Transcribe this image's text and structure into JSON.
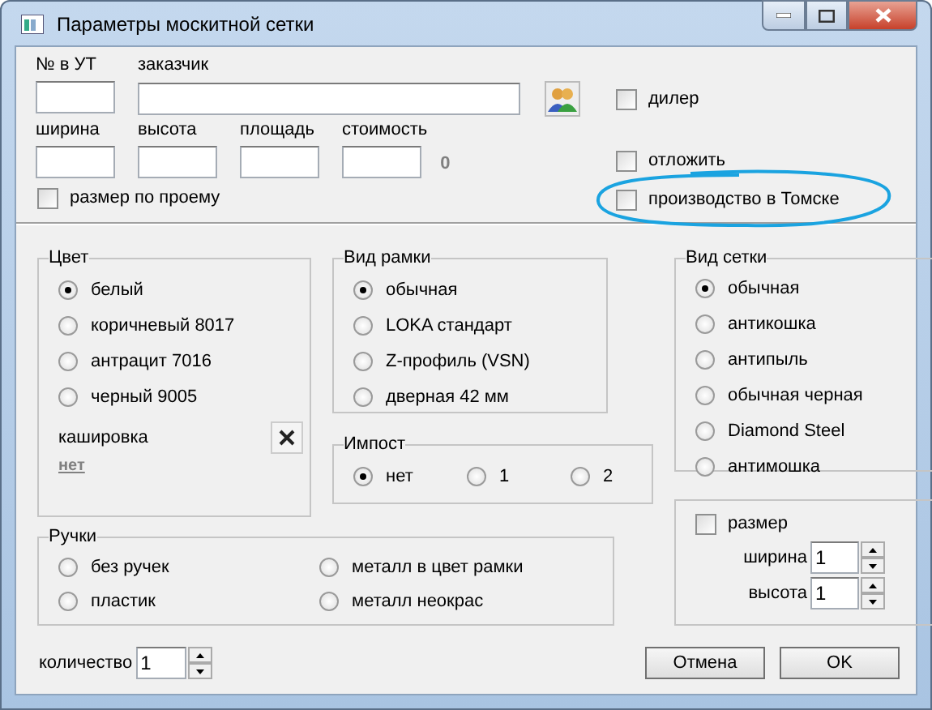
{
  "window": {
    "title": "Параметры москитной сетки"
  },
  "order_fields": [
    {
      "label": "№ в УТ",
      "kind": "short"
    },
    {
      "label": "заказчик",
      "kind": "lookup"
    }
  ],
  "size_fields": [
    {
      "label": "ширина"
    },
    {
      "label": "высота"
    },
    {
      "label": "площадь"
    },
    {
      "label": "стоимость"
    }
  ],
  "cost_total": "0",
  "size_by_opening": {
    "label": "размер по проему",
    "checked": false
  },
  "options": [
    {
      "label": "дилер",
      "checked": false,
      "highlighted": false
    },
    {
      "label": "отложить",
      "checked": false,
      "highlighted": false
    },
    {
      "label": "производство в Томске",
      "checked": false,
      "highlighted": true
    }
  ],
  "color_group": {
    "title": "Цвет",
    "options": [
      {
        "label": "белый",
        "selected": true
      },
      {
        "label": "коричневый 8017",
        "selected": false
      },
      {
        "label": "антрацит 7016",
        "selected": false
      },
      {
        "label": "черный 9005",
        "selected": false
      }
    ],
    "lamination_label": "кашировка",
    "lamination_value": "нет"
  },
  "frame_group": {
    "title": "Вид рамки",
    "options": [
      {
        "label": "обычная",
        "selected": true
      },
      {
        "label": "LOKA стандарт",
        "selected": false
      },
      {
        "label": "Z-профиль (VSN)",
        "selected": false
      },
      {
        "label": "дверная 42 мм",
        "selected": false
      }
    ]
  },
  "impost_group": {
    "title": "Импост",
    "options": [
      {
        "label": "нет",
        "selected": true
      },
      {
        "label": "1",
        "selected": false
      },
      {
        "label": "2",
        "selected": false
      }
    ]
  },
  "mesh_group": {
    "title": "Вид сетки",
    "options": [
      {
        "label": "обычная",
        "selected": true
      },
      {
        "label": "антикошка",
        "selected": false
      },
      {
        "label": "антипыль",
        "selected": false
      },
      {
        "label": "обычная черная",
        "selected": false
      },
      {
        "label": "Diamond Steel",
        "selected": false
      },
      {
        "label": "антимошка",
        "selected": false
      }
    ]
  },
  "handles_group": {
    "title": "Ручки",
    "options": [
      {
        "label": "без ручек",
        "selected": false
      },
      {
        "label": "пластик",
        "selected": false
      },
      {
        "label": "металл в цвет рамки",
        "selected": false
      },
      {
        "label": "металл неокрас",
        "selected": false
      }
    ]
  },
  "custom_size": {
    "label": "размер",
    "checked": false,
    "fields": [
      {
        "label": "ширина",
        "value": "1"
      },
      {
        "label": "высота",
        "value": "1"
      }
    ]
  },
  "quantity": {
    "label": "количество",
    "value": "1"
  },
  "buttons": [
    "Отмена",
    "OK"
  ]
}
